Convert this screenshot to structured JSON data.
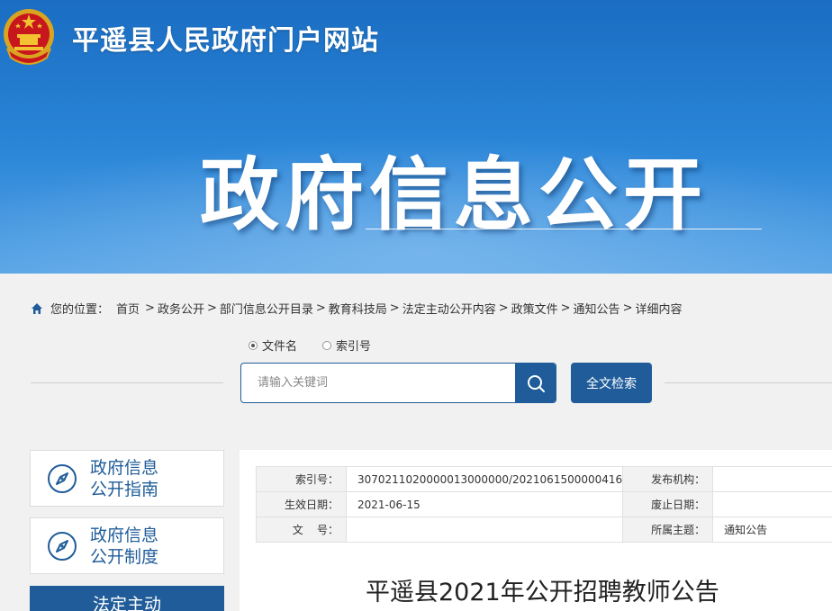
{
  "header": {
    "site_title": "平遥县人民政府门户网站",
    "hero_title": "政府信息公开"
  },
  "breadcrumb": {
    "label": "您的位置：",
    "items": [
      "首页",
      "政务公开",
      "部门信息公开目录",
      "教育科技局",
      "法定主动公开内容",
      "政策文件",
      "通知公告",
      "详细内容"
    ],
    "separator": ">"
  },
  "search": {
    "options": [
      {
        "label": "文件名",
        "checked": true
      },
      {
        "label": "索引号",
        "checked": false
      }
    ],
    "placeholder": "请输入关键词",
    "fulltext_button": "全文检索"
  },
  "sidebar": {
    "items": [
      {
        "line1": "政府信息",
        "line2": "公开指南"
      },
      {
        "line1": "政府信息",
        "line2": "公开制度"
      }
    ],
    "active_label": "法定主动"
  },
  "meta": {
    "index_label": "索引号：",
    "index_value": "3070211020000013000000/2021061500000416",
    "publisher_label": "发布机构：",
    "publisher_value": "",
    "effective_label": "生效日期：",
    "effective_value": "2021-06-15",
    "expiry_label": "废止日期：",
    "expiry_value": "",
    "docno_label": "文    号：",
    "docno_value": "",
    "topic_label": "所属主题：",
    "topic_value": "通知公告"
  },
  "document": {
    "title": "平遥县2021年公开招聘教师公告"
  },
  "colors": {
    "primary": "#1f5c99",
    "banner_top": "#1a6dc2",
    "background": "#f1f1f1"
  }
}
